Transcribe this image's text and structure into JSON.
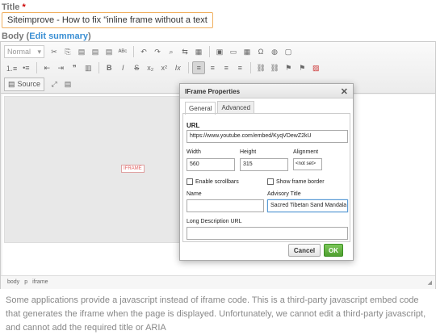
{
  "title_field": {
    "label": "Title",
    "required": "*",
    "value": "Siteimprove - How to fix \"inline frame without a text alternative\""
  },
  "body_field": {
    "label": "Body (",
    "edit_summary": "Edit summary",
    "close_paren": ")"
  },
  "toolbar": {
    "format_label": "Normal",
    "format_arrow": "▾",
    "source_label": "Source",
    "buttons_row1": [
      "✂",
      "⎘",
      "📋",
      "📋",
      "📋",
      "ABC",
      "↶",
      "↷",
      "🔍",
      "ab",
      "▤",
      "🖼",
      "🎞",
      "▦",
      "Ω",
      "⚙",
      "▢"
    ],
    "buttons_row2": [
      "⁝≡",
      "•≡",
      "⇤",
      "⇥",
      "❞",
      "⁞",
      "B",
      "I",
      "S",
      "x₂",
      "x²",
      "Ix",
      "≡",
      "≡",
      "≡",
      "≡",
      "🔗",
      "⛓",
      "⚑",
      "⚑",
      "▨"
    ]
  },
  "iframe_placeholder": "IFRAME",
  "paragraph": "Some applications provide a javascript instead of iframe code. This is a third-party javascript embed code that generates the iframe when the page is displayed.  Unfortunately, we cannot edit a third-party javascript, and cannot add the required title or ARIA",
  "statusbar": [
    "body",
    "p",
    "iframe"
  ],
  "dialog": {
    "title": "IFrame Properties",
    "close": "✕",
    "tabs": [
      "General",
      "Advanced"
    ],
    "url_label": "URL",
    "url_value": "https://www.youtube.com/embed/KyqVDewZ2kU",
    "width_label": "Width",
    "width_value": "560",
    "height_label": "Height",
    "height_value": "315",
    "alignment_label": "Alignment",
    "alignment_value": "<not set>",
    "scrollbars_label": "Enable scrollbars",
    "frameborder_label": "Show frame border",
    "name_label": "Name",
    "name_value": "",
    "advisory_label": "Advisory Title",
    "advisory_value": "Sacred Tibetan Sand Mandala",
    "longdesc_label": "Long Description URL",
    "longdesc_value": "",
    "cancel_label": "Cancel",
    "ok_label": "OK"
  }
}
